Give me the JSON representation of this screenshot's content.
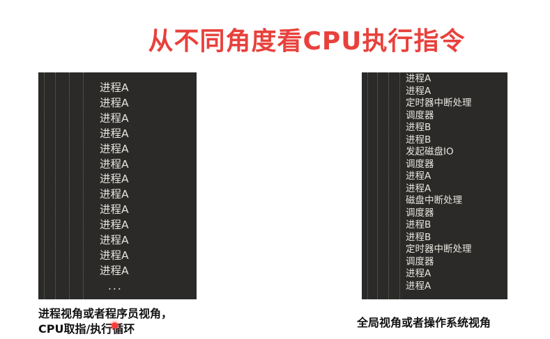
{
  "title": "从不同角度看CPU执行指令",
  "left_panel": {
    "lines": [
      "进程A",
      "进程A",
      "进程A",
      "进程A",
      "进程A",
      "进程A",
      "进程A",
      "进程A",
      "进程A",
      "进程A",
      "进程A",
      "进程A",
      "进程A"
    ],
    "ellipsis": "..."
  },
  "right_panel": {
    "lines": [
      "进程A",
      "进程A",
      "定时器中断处理",
      "调度器",
      "进程B",
      "进程B",
      "发起磁盘IO",
      "调度器",
      "进程A",
      "进程A",
      "磁盘中断处理",
      "调度器",
      "进程B",
      "进程B",
      "定时器中断处理",
      "调度器",
      "进程A",
      "进程A"
    ]
  },
  "captions": {
    "left_line1": "进程视角或者程序员视角，",
    "left_line2": "CPU取指/执行循环",
    "right": "全局视角或者操作系统视角"
  },
  "colors": {
    "title": "#e8413c",
    "panel_background": "#2b2a28",
    "panel_text": "#e6e6e0",
    "pointer": "#ff3b3b"
  }
}
